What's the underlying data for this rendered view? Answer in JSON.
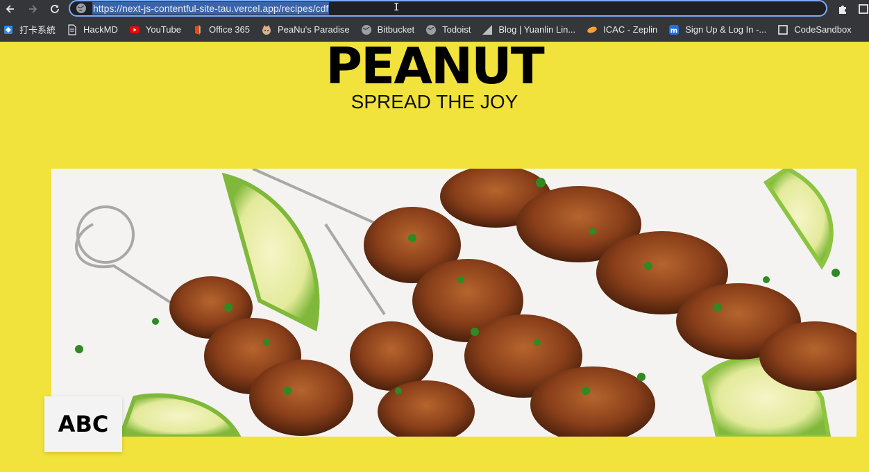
{
  "browser": {
    "url": "https://next-js-contentful-site-tau.vercel.app/recipes/cdf",
    "bookmarks": [
      {
        "label": "打卡系統",
        "icon": "diamond-icon",
        "color": "#2a8ae8"
      },
      {
        "label": "HackMD",
        "icon": "document-icon",
        "color": "#e8eaed"
      },
      {
        "label": "YouTube",
        "icon": "youtube-icon",
        "color": "#ff0000"
      },
      {
        "label": "Office 365",
        "icon": "office-icon",
        "color": "#e64a19"
      },
      {
        "label": "PeaNu's Paradise",
        "icon": "cat-icon",
        "color": "#d7b38c"
      },
      {
        "label": "Bitbucket",
        "icon": "globe-icon",
        "color": "#9aa0a6"
      },
      {
        "label": "Todoist",
        "icon": "globe-icon",
        "color": "#9aa0a6"
      },
      {
        "label": "Blog | Yuanlin Lin...",
        "icon": "triangle-icon",
        "color": "#bdbdbd"
      },
      {
        "label": "ICAC - Zeplin",
        "icon": "zeplin-icon",
        "color": "#f7a137"
      },
      {
        "label": "Sign Up & Log In -...",
        "icon": "m-icon",
        "color": "#1f6fe5"
      },
      {
        "label": "CodeSandbox",
        "icon": "codesandbox-icon",
        "color": "#e8eaed"
      }
    ]
  },
  "page": {
    "brand": "PEANUT",
    "tagline": "SPREAD THE JOY",
    "recipe_label": "ABC",
    "colors": {
      "background": "#f2e23c",
      "text": "#000000"
    }
  }
}
